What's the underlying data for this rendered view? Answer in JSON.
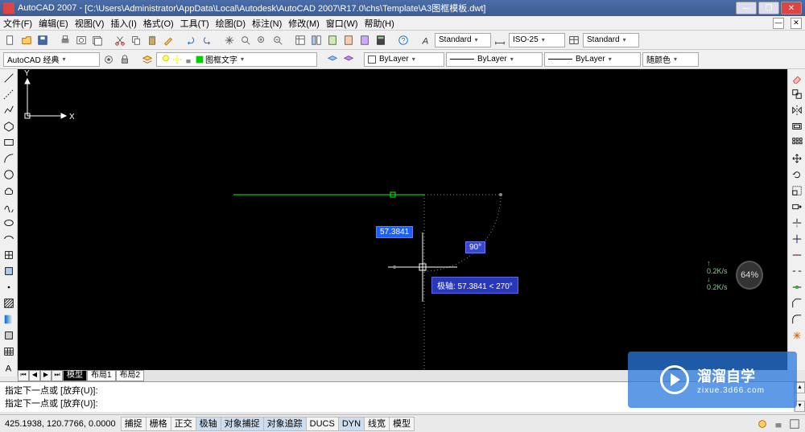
{
  "window": {
    "app": "AutoCAD 2007",
    "path": "[C:\\Users\\Administrator\\AppData\\Local\\Autodesk\\AutoCAD 2007\\R17.0\\chs\\Template\\A3图框模板.dwt]"
  },
  "menu": {
    "items": [
      "文件(F)",
      "编辑(E)",
      "视图(V)",
      "插入(I)",
      "格式(O)",
      "工具(T)",
      "绘图(D)",
      "标注(N)",
      "修改(M)",
      "窗口(W)",
      "帮助(H)"
    ]
  },
  "toolbar1": {
    "text_style": "Standard",
    "dim_style": "ISO-25",
    "table_style": "Standard"
  },
  "toolbar2": {
    "workspace": "AutoCAD 经典",
    "layer_name": "图框文字",
    "color": "ByLayer",
    "linetype": "ByLayer",
    "lineweight": "ByLayer",
    "plotstyle": "随颜色"
  },
  "drawing": {
    "input_distance": "57.3841",
    "input_angle": "90°",
    "polar_tip": "极轴: 57.3841 < 270°",
    "axis_x": "X",
    "axis_y": "Y"
  },
  "tabs": {
    "items": [
      "模型",
      "布局1",
      "布局2"
    ],
    "active": 0
  },
  "command": {
    "line1": "指定下一点或 [放弃(U)]:",
    "line2": "指定下一点或 [放弃(U)]:"
  },
  "status": {
    "coords": "425.1938, 120.7766, 0.0000",
    "toggles": [
      "捕捉",
      "栅格",
      "正交",
      "极轴",
      "对象捕捉",
      "对象追踪",
      "DUCS",
      "DYN",
      "线宽",
      "模型"
    ],
    "active": [
      3,
      4,
      5,
      7
    ]
  },
  "overlay": {
    "brand_big": "溜溜自学",
    "brand_small": "zixue.3d66.com"
  },
  "speed": {
    "up": "↑ 0.2K/s",
    "down": "↓ 0.2K/s",
    "pct": "64%"
  }
}
